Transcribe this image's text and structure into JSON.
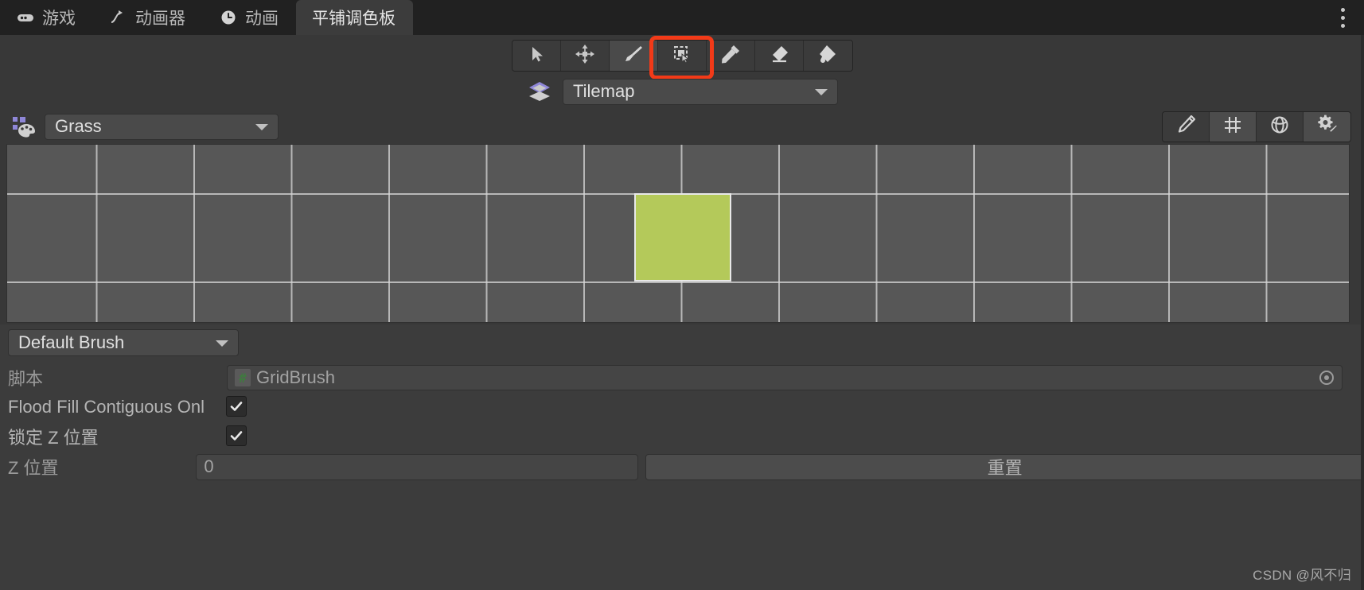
{
  "window": {
    "title": "平铺调色板",
    "menu_icon": "kebab-menu-icon"
  },
  "tabs": [
    {
      "label": "游戏",
      "icon": "gamepad-icon",
      "active": false
    },
    {
      "label": "动画器",
      "icon": "animator-icon",
      "active": false
    },
    {
      "label": "动画",
      "icon": "clock-icon",
      "active": false
    },
    {
      "label": "平铺调色板",
      "icon": "",
      "active": true
    }
  ],
  "toolbar": {
    "tools": [
      {
        "name": "select-tool",
        "icon": "cursor-arrow-icon",
        "active": false
      },
      {
        "name": "move-tool",
        "icon": "move-arrows-icon",
        "active": false
      },
      {
        "name": "paint-brush-tool",
        "icon": "paintbrush-icon",
        "active": true
      },
      {
        "name": "box-select-tool",
        "icon": "marquee-select-icon",
        "active": false,
        "highlighted": true
      },
      {
        "name": "picker-tool",
        "icon": "eyedropper-icon",
        "active": false
      },
      {
        "name": "eraser-tool",
        "icon": "eraser-icon",
        "active": false
      },
      {
        "name": "fill-tool",
        "icon": "paint-bucket-icon",
        "active": false
      }
    ],
    "highlight_color": "#f23a18"
  },
  "tilemap_row": {
    "icon": "layers-icon",
    "dropdown_value": "Tilemap"
  },
  "palette_row": {
    "icon": "palette-icon",
    "dropdown_value": "Grass",
    "right_buttons": [
      {
        "name": "edit-palette-button",
        "icon": "pencil-icon",
        "active": false
      },
      {
        "name": "grid-toggle-button",
        "icon": "grid-icon",
        "active": true
      },
      {
        "name": "gizmo-button",
        "icon": "globe-gizmo-icon",
        "active": false
      },
      {
        "name": "settings-button",
        "icon": "gear-brush-icon",
        "active": true
      }
    ]
  },
  "palette_grid": {
    "selected_tile": {
      "column": 7,
      "row": 1,
      "color": "#b4c95a"
    },
    "cell_size": 122,
    "background_color": "#575757",
    "gridline_color": "#d7d7d7"
  },
  "brush_inspector": {
    "brush_dropdown": "Default Brush",
    "rows": [
      {
        "label": "脚本",
        "type": "object",
        "value": "GridBrush",
        "badge": "#"
      },
      {
        "label": "Flood Fill Contiguous Onl",
        "type": "checkbox",
        "checked": true
      },
      {
        "label": "锁定 Z 位置",
        "type": "checkbox",
        "checked": true
      },
      {
        "label": "Z 位置",
        "type": "number",
        "value": "0"
      }
    ],
    "reset_label": "重置"
  },
  "watermark": "CSDN @风不归"
}
